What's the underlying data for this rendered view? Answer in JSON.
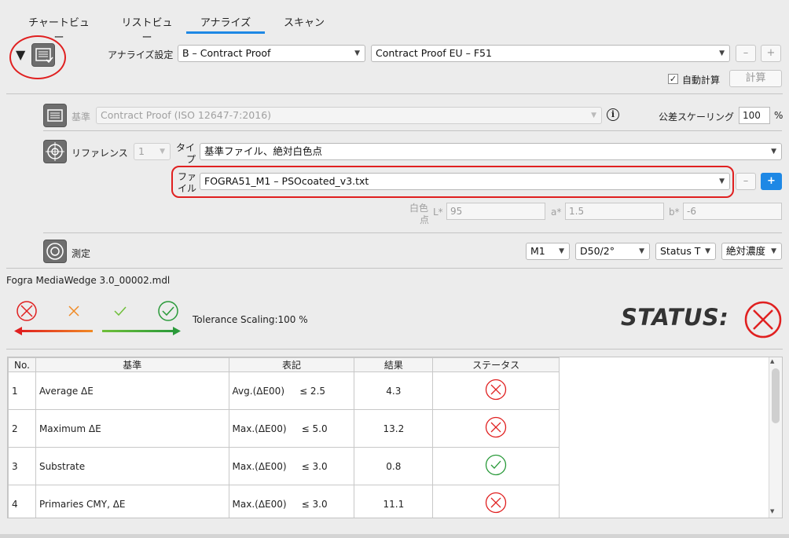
{
  "tabs": [
    "チャートビュー",
    "リストビュー",
    "アナライズ",
    "スキャン"
  ],
  "active_tab": "アナライズ",
  "analyze": {
    "settings_label": "アナライズ設定",
    "settings_value": "B – Contract Proof",
    "profile_value": "Contract Proof EU – F51",
    "minus": "–",
    "plus": "+",
    "auto_calc_label": "自動計算",
    "auto_calc_checked": "✓",
    "calc_button": "計算"
  },
  "standard": {
    "label": "基準",
    "value": "Contract Proof (ISO 12647-7:2016)",
    "info": "i",
    "tolerance_label": "公差スケーリング",
    "tolerance_value": "100",
    "tolerance_unit": "%"
  },
  "reference": {
    "label": "リファレンス",
    "index": "1",
    "type_label_1": "タイ",
    "type_label_2": "プ",
    "type_value": "基準ファイル、絶対白色点",
    "file_label_1": "ファ",
    "file_label_2": "イル",
    "file_value": "FOGRA51_M1 – PSOcoated_v3.txt",
    "minus": "–",
    "plus": "+",
    "white_label_1": "白色",
    "white_label_2": "点",
    "L_label": "L*",
    "L_value": "95",
    "a_label": "a*",
    "a_value": "1.5",
    "b_label": "b*",
    "b_value": "-6"
  },
  "measurement": {
    "label": "測定",
    "mode": "M1",
    "illuminant": "D50/2°",
    "status": "Status T",
    "density": "絶対濃度"
  },
  "file_name": "Fogra MediaWedge 3.0_00002.mdl",
  "legend": {
    "tolerance_text": "Tolerance Scaling:100 %",
    "status_label": "STATUS:"
  },
  "colors": {
    "fail": "#e02020",
    "warn": "#f08a24",
    "pass_light": "#6fbf3a",
    "pass": "#2a9a3a",
    "accent": "#1e88e5"
  },
  "table": {
    "headers": [
      "No.",
      "基準",
      "表記",
      "結果",
      "ステータス"
    ],
    "rows": [
      {
        "no": "1",
        "name": "Average ΔE",
        "spec": "Avg.(ΔE00)     ≤ 2.5",
        "result": "4.3",
        "status": "fail"
      },
      {
        "no": "2",
        "name": "Maximum ΔE",
        "spec": "Max.(ΔE00)     ≤ 5.0",
        "result": "13.2",
        "status": "fail"
      },
      {
        "no": "3",
        "name": "Substrate",
        "spec": "Max.(ΔE00)     ≤ 3.0",
        "result": "0.8",
        "status": "pass"
      },
      {
        "no": "4",
        "name": "Primaries CMY, ΔE",
        "spec": "Max.(ΔE00)     ≤ 3.0",
        "result": "11.1",
        "status": "fail"
      }
    ]
  }
}
